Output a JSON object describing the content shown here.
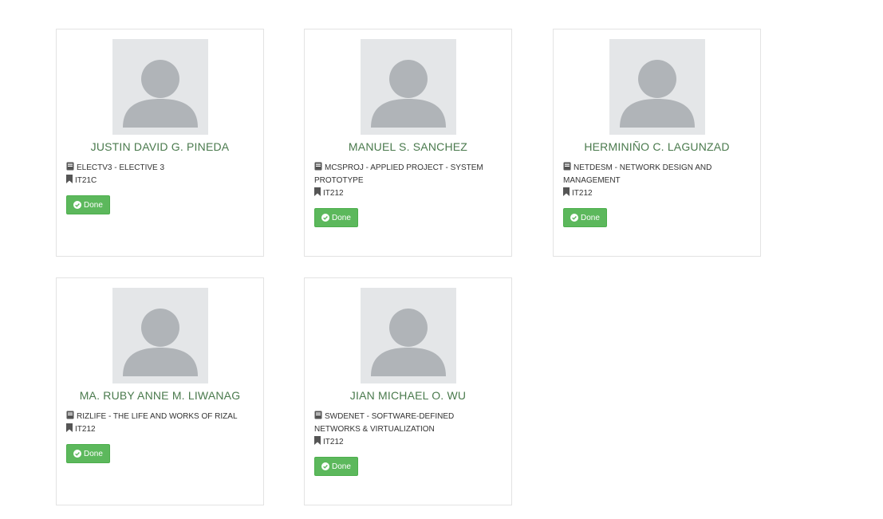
{
  "cards": [
    {
      "name": "JUSTIN DAVID G. PINEDA",
      "subject": "ELECTV3 - ELECTIVE 3",
      "section": "IT21C",
      "button": "Done"
    },
    {
      "name": "MANUEL S. SANCHEZ",
      "subject": "MCSPROJ - APPLIED PROJECT - SYSTEM PROTOTYPE",
      "section": "IT212",
      "button": "Done"
    },
    {
      "name": "HERMINIÑO C. LAGUNZAD",
      "subject": "NETDESM - NETWORK DESIGN AND MANAGEMENT",
      "section": "IT212",
      "button": "Done"
    },
    {
      "name": "MA. RUBY ANNE M. LIWANAG",
      "subject": "RIZLIFE - THE LIFE AND WORKS OF RIZAL",
      "section": "IT212",
      "button": "Done"
    },
    {
      "name": "JIAN MICHAEL O. WU",
      "subject": "SWDENET - SOFTWARE-DEFINED NETWORKS & VIRTUALIZATION",
      "section": "IT212",
      "button": "Done"
    }
  ],
  "colors": {
    "name_text": "#4a7a4d",
    "button_bg": "#5cb85c",
    "avatar_bg": "#e4e6e8",
    "avatar_figure": "#b0b4b8"
  },
  "icons": {
    "subject": "book-icon",
    "section": "bookmark-icon",
    "button": "check-circle-icon"
  }
}
